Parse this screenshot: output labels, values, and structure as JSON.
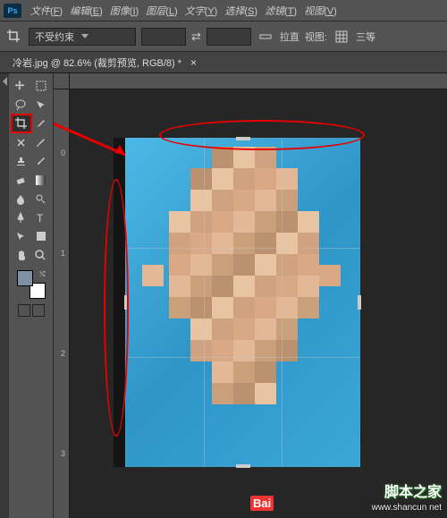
{
  "menubar": {
    "app_icon": "Ps",
    "items": [
      {
        "label": "文件",
        "accel": "F"
      },
      {
        "label": "编辑",
        "accel": "E"
      },
      {
        "label": "图像",
        "accel": "I"
      },
      {
        "label": "图层",
        "accel": "L"
      },
      {
        "label": "文字",
        "accel": "Y"
      },
      {
        "label": "选择",
        "accel": "S"
      },
      {
        "label": "滤镜",
        "accel": "T"
      },
      {
        "label": "视图",
        "accel": "V"
      }
    ]
  },
  "options_bar": {
    "preset": "不受约束",
    "swap_icon": "⇄",
    "straighten": "拉直",
    "view_label": "视图:",
    "grid_label": "三等"
  },
  "document": {
    "tab_title": "冷岩.jpg @ 82.6% (裁剪预览, RGB/8) *",
    "close": "×"
  },
  "ruler": {
    "v_ticks": [
      "0",
      "1",
      "2",
      "3"
    ]
  },
  "swatches": {
    "swap": "⤭"
  },
  "watermark": {
    "main": "脚本之家",
    "sub": "www.shancun net",
    "bai": "Bai"
  }
}
